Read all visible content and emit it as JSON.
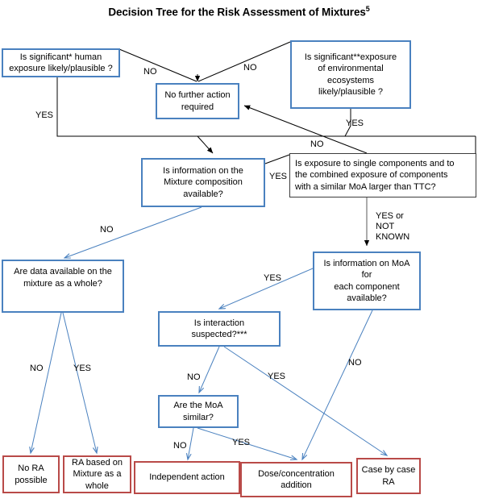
{
  "title": {
    "main": "Decision Tree for the Risk Assessment of Mixtures",
    "superscript": "5"
  },
  "colors": {
    "blue_border": "#4a81bf",
    "red_border": "#b94a48",
    "black_border": "#3c3c3c",
    "blue_arrow": "#4a81bf",
    "black_arrow": "#000000",
    "background": "#ffffff",
    "text": "#000000"
  },
  "nodes": {
    "human_exposure": "Is significant* human\nexposure likely/plausible ?",
    "env_exposure": "Is significant**exposure\nof environmental\necosystems\nlikely/plausible ?",
    "no_further_action": "No further action\nrequired",
    "mixture_composition": "Is information on the\nMixture composition\navailable?",
    "ttc": "Is exposure to single components and to\nthe combined exposure of components\nwith a similar MoA larger than TTC?",
    "mixture_as_whole": "Are data available on the\nmixture as a whole?",
    "moa_info": "Is information on MoA\nfor\neach component\navailable?",
    "interaction": "Is interaction\nsuspected?***",
    "moa_similar": "Are the MoA\nsimilar?",
    "no_ra": "No RA\npossible",
    "ra_mixture_whole": "RA based on\nMixture as a\nwhole",
    "independent_action": "Independent action",
    "dose_addition": "Dose/concentration\naddition",
    "case_by_case": "Case by case\nRA"
  },
  "edge_labels": {
    "human_no": "NO",
    "env_no": "NO",
    "human_yes": "YES",
    "env_yes": "YES",
    "ttc_no": "NO",
    "mixture_yes": "YES",
    "mixture_no": "NO",
    "ttc_yes_not_known": "YES or\nNOT\nKNOWN",
    "moa_yes": "YES",
    "moa_no": "NO",
    "whole_no": "NO",
    "whole_yes": "YES",
    "interaction_no": "NO",
    "interaction_yes": "YES",
    "similar_no": "NO",
    "similar_yes": "YES"
  }
}
